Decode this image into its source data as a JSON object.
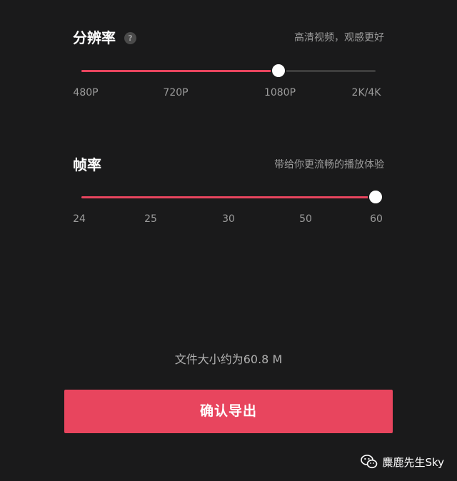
{
  "resolution": {
    "title": "分辨率",
    "help_icon": "question-mark-icon",
    "hint": "高清视频，观感更好",
    "ticks": [
      "480P",
      "720P",
      "1080P",
      "2K/4K"
    ],
    "selected": "1080P",
    "selected_index": 2
  },
  "frame_rate": {
    "title": "帧率",
    "hint": "带给你更流畅的播放体验",
    "ticks": [
      "24",
      "25",
      "30",
      "50",
      "60"
    ],
    "selected": "60",
    "selected_index": 4
  },
  "file_size_text": "文件大小约为60.8 M",
  "export_button_label": "确认导出",
  "watermark": {
    "icon": "wechat-icon",
    "text": "麋鹿先生Sky"
  },
  "colors": {
    "background": "#1a1a1b",
    "accent": "#e8455e",
    "track": "#3d3d3d",
    "muted_text": "#9c9c9c"
  }
}
